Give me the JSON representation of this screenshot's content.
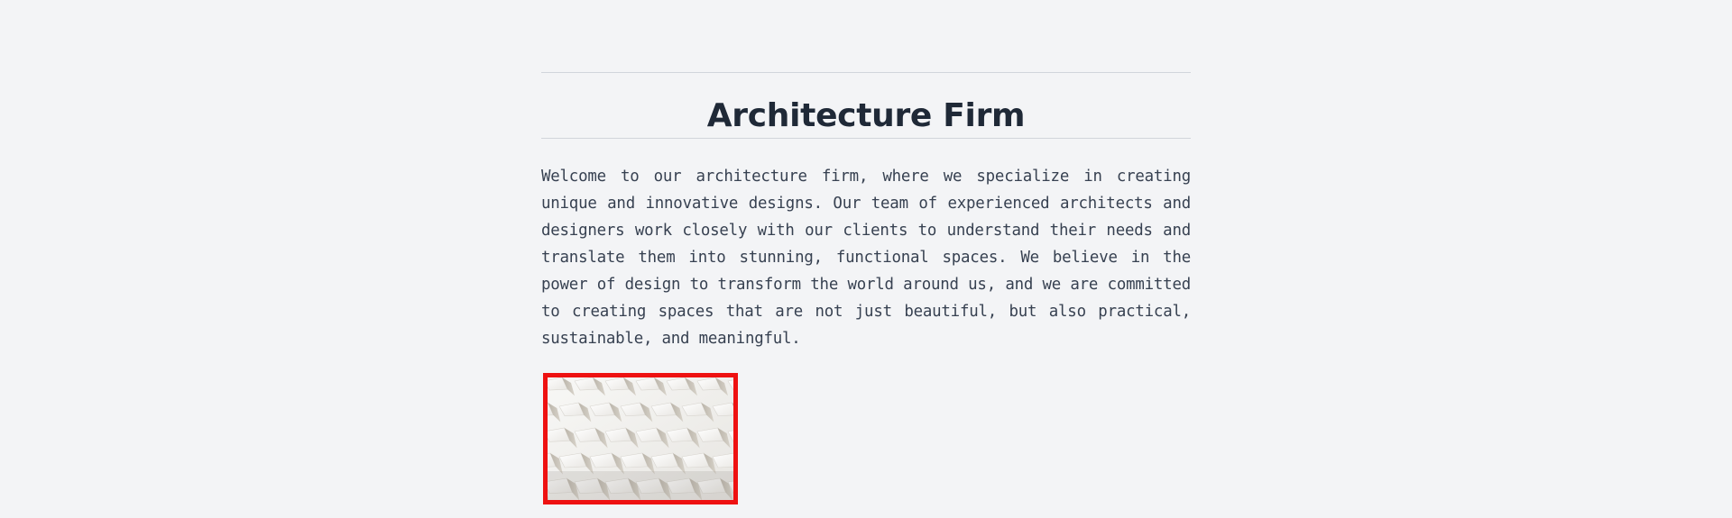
{
  "header": {
    "title": "Architecture Firm"
  },
  "main": {
    "intro": "Welcome to our architecture firm, where we specialize in creating unique and innovative designs. Our team of experienced architects and designers work closely with our clients to understand their needs and translate them into stunning, functional spaces. We believe in the power of design to transform the world around us, and we are committed to creating spaces that are not just beautiful, but also practical, sustainable, and meaningful."
  },
  "image": {
    "description": "architectural-facade-photo"
  },
  "colors": {
    "background": "#f3f4f6",
    "title": "#1f2937",
    "text": "#374151",
    "divider": "#d1d5db",
    "image_border": "#ee1111"
  }
}
